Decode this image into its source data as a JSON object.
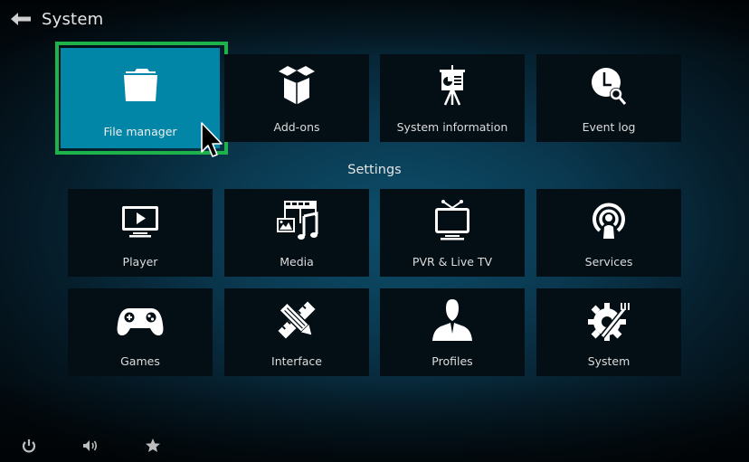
{
  "header": {
    "title": "System",
    "back_icon": "arrow-left-icon"
  },
  "top_row": [
    {
      "label": "File manager",
      "icon": "folder-icon",
      "focused": true
    },
    {
      "label": "Add-ons",
      "icon": "open-box-icon"
    },
    {
      "label": "System information",
      "icon": "presentation-easel-icon"
    },
    {
      "label": "Event log",
      "icon": "clock-search-icon"
    }
  ],
  "settings": {
    "heading": "Settings",
    "items": [
      {
        "label": "Player",
        "icon": "tv-play-icon"
      },
      {
        "label": "Media",
        "icon": "media-film-music-icon"
      },
      {
        "label": "PVR & Live TV",
        "icon": "retro-tv-antenna-icon"
      },
      {
        "label": "Services",
        "icon": "broadcast-user-icon"
      },
      {
        "label": "Games",
        "icon": "gamepad-icon"
      },
      {
        "label": "Interface",
        "icon": "pencil-ruler-icon"
      },
      {
        "label": "Profiles",
        "icon": "user-silhouette-icon"
      },
      {
        "label": "System",
        "icon": "gear-tools-icon"
      }
    ]
  },
  "bottom_bar": [
    {
      "name": "power",
      "icon": "power-icon"
    },
    {
      "name": "volume",
      "icon": "volume-icon"
    },
    {
      "name": "favourites",
      "icon": "star-icon"
    }
  ],
  "colors": {
    "focus_tile": "#0286a7",
    "focus_ring": "#1eb24a",
    "tile_bg": "#040f15",
    "text": "#e2e2e2"
  }
}
